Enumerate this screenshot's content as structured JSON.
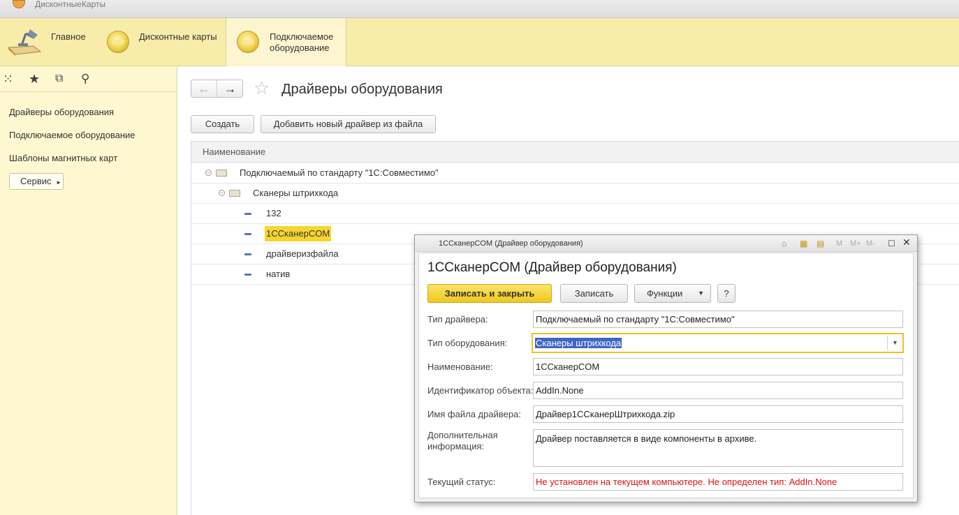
{
  "window": {
    "title": "ДисконтныеКарты"
  },
  "sections": {
    "main": "Главное",
    "cards": "Дисконтные карты",
    "equipment": "Подключаемое оборудование"
  },
  "sidebar": {
    "items": [
      "Драйверы оборудования",
      "Подключаемое оборудование",
      "Шаблоны магнитных карт"
    ],
    "service_label": "Сервис"
  },
  "page": {
    "title": "Драйверы оборудования",
    "create_label": "Создать",
    "add_from_file_label": "Добавить новый драйвер из файла"
  },
  "list": {
    "column_header": "Наименование",
    "rows": [
      {
        "label": "Подключаемый по стандарту \"1С:Совместимо\"",
        "level": 0,
        "kind": "group"
      },
      {
        "label": "Сканеры штрихкода",
        "level": 1,
        "kind": "group"
      },
      {
        "label": "132",
        "level": 2,
        "kind": "item"
      },
      {
        "label": "1ССканерCOM",
        "level": 2,
        "kind": "item",
        "selected": true
      },
      {
        "label": "драйверизфайла",
        "level": 2,
        "kind": "item"
      },
      {
        "label": "натив",
        "level": 2,
        "kind": "item"
      }
    ]
  },
  "dialog": {
    "window_title": "1ССканерCOM (Драйвер оборудования)",
    "heading": "1ССканерCOM (Драйвер оборудования)",
    "titlebar_buttons": [
      "M",
      "M+",
      "M-"
    ],
    "save_close_label": "Записать и закрыть",
    "save_label": "Записать",
    "functions_label": "Функции",
    "help_label": "?",
    "fields": {
      "driver_type_label": "Тип драйвера:",
      "driver_type_value": "Подключаемый по стандарту \"1С:Совместимо\"",
      "equipment_type_label": "Тип оборудования:",
      "equipment_type_value": "Сканеры штрихкода",
      "name_label": "Наименование:",
      "name_value": "1ССканерCOM",
      "object_id_label": "Идентификатор объекта:",
      "object_id_value": "AddIn.None",
      "file_name_label": "Имя файла драйвера:",
      "file_name_value": "Драйвер1ССканерШтрихкода.zip",
      "extra_info_label": "Дополнительная информация:",
      "extra_info_value": "Драйвер поставляется в виде компоненты в архиве.",
      "status_label": "Текущий статус:",
      "status_value": "Не установлен на текущем компьютере. Не определен тип: AddIn.None"
    }
  },
  "colors": {
    "sections_bg": "#f8ecaa",
    "sidebar_bg": "#fdf8cf",
    "selection": "#f7d531",
    "primary_button": "#f0c81c",
    "status_text": "#dd1111"
  }
}
